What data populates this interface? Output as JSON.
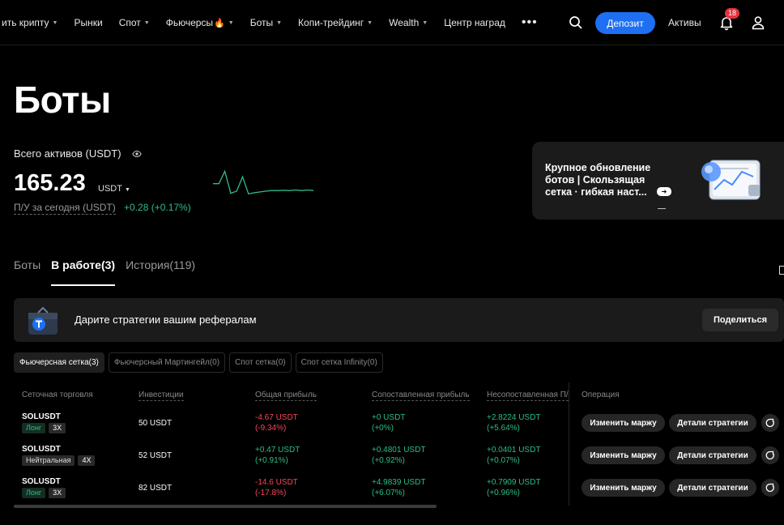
{
  "nav": {
    "items": [
      {
        "label": "ить крипту",
        "caret": true
      },
      {
        "label": "Рынки",
        "caret": false
      },
      {
        "label": "Спот",
        "caret": true
      },
      {
        "label": "Фьючерсы",
        "caret": true,
        "fire": true
      },
      {
        "label": "Боты",
        "caret": true
      },
      {
        "label": "Копи-трейдинг",
        "caret": true
      },
      {
        "label": "Wealth",
        "caret": true
      },
      {
        "label": "Центр наград",
        "caret": false
      }
    ],
    "more": "•••",
    "deposit": "Депозит",
    "assets": "Активы",
    "notifications": "18"
  },
  "page": {
    "title": "Боты",
    "total_label": "Всего активов (USDT)",
    "total_value": "165.23",
    "total_currency": "USDT",
    "pnl_label": "П/У за сегодня (USDT)",
    "pnl_value": "+0.28 (+0.17%)"
  },
  "sparkline": [
    0.55,
    0.55,
    0.1,
    0.9,
    0.82,
    0.3,
    0.92,
    0.88,
    0.85,
    0.82,
    0.8,
    0.8,
    0.79,
    0.8,
    0.78,
    0.8,
    0.78,
    0.8
  ],
  "promo": {
    "title": "Крупное обновление ботов | Скользящая сетка · гибкая наст..."
  },
  "tabs": [
    {
      "label": "Боты",
      "active": false
    },
    {
      "label": "В работе(3)",
      "active": true
    },
    {
      "label": "История(119)",
      "active": false
    }
  ],
  "referral": {
    "text": "Дарите стратегии вашим рефералам",
    "button": "Поделиться"
  },
  "filters": [
    {
      "label": "Фьючерсная сетка(3)",
      "active": true
    },
    {
      "label": "Фьючерсный Мартингейл(0)",
      "active": false
    },
    {
      "label": "Спот сетка(0)",
      "active": false
    },
    {
      "label": "Спот сетка Infinity(0)",
      "active": false
    }
  ],
  "table": {
    "headers": [
      "Сеточная торговля",
      "Инвестиции",
      "Общая прибыль",
      "Сопоставленная прибыль",
      "Несопоставленная П/У",
      "Операция"
    ],
    "rows": [
      {
        "pair": "SOLUSDT",
        "side": "Лонг",
        "side_type": "long",
        "lev": "3X",
        "invest": "50 USDT",
        "total": "-4.67 USDT",
        "total_pct": "(-9.34%)",
        "total_neg": true,
        "matched": "+0 USDT",
        "matched_pct": "(+0%)",
        "unmatched": "+2.8224 USDT",
        "unmatched_pct": "(+5.64%)"
      },
      {
        "pair": "SOLUSDT",
        "side": "Нейтральная",
        "side_type": "neutral",
        "lev": "4X",
        "invest": "52 USDT",
        "total": "+0.47 USDT",
        "total_pct": "(+0.91%)",
        "total_neg": false,
        "matched": "+0.4801 USDT",
        "matched_pct": "(+0.92%)",
        "unmatched": "+0.0401 USDT",
        "unmatched_pct": "(+0.07%)"
      },
      {
        "pair": "SOLUSDT",
        "side": "Лонг",
        "side_type": "long",
        "lev": "3X",
        "invest": "82 USDT",
        "total": "-14.6 USDT",
        "total_pct": "(-17.8%)",
        "total_neg": true,
        "matched": "+4.9839 USDT",
        "matched_pct": "(+6.07%)",
        "unmatched": "+0.7909 USDT",
        "unmatched_pct": "(+0.96%)"
      }
    ],
    "btn_margin": "Изменить маржу",
    "btn_details": "Детали стратегии"
  },
  "colors": {
    "accent": "#1e6ff2",
    "positive": "#2ebd85",
    "negative": "#f6465d",
    "card": "#1b1b1b"
  }
}
